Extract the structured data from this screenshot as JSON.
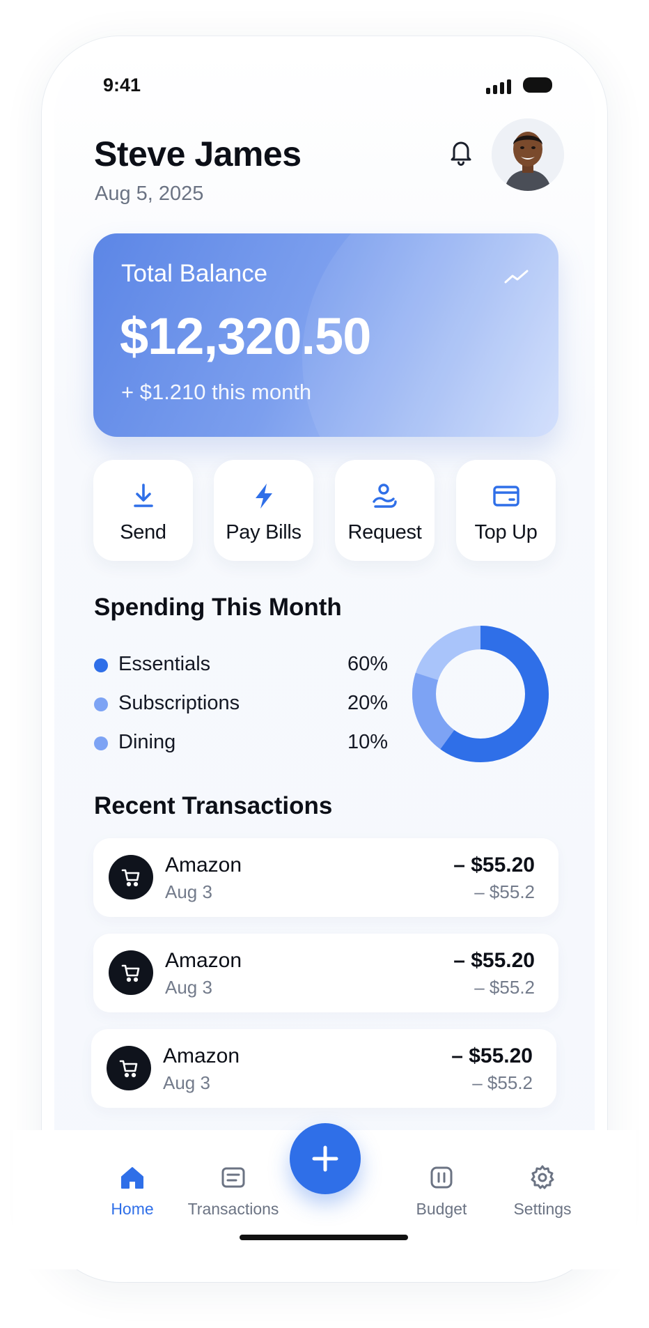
{
  "status_bar": {
    "time": "9:41"
  },
  "header": {
    "user_name": "Steve James",
    "date": "Aug 5, 2025"
  },
  "balance": {
    "label": "Total Balance",
    "amount": "$12,320.50",
    "change": "+ $1.210 this month"
  },
  "actions": [
    {
      "label": "Send",
      "icon": "download-arrow-icon"
    },
    {
      "label": "Pay Bills",
      "icon": "lightning-icon"
    },
    {
      "label": "Request",
      "icon": "request-person-icon"
    },
    {
      "label": "Top Up",
      "icon": "card-icon"
    }
  ],
  "spending": {
    "title": "Spending This Month",
    "items": [
      {
        "label": "Essentials",
        "value": "60%",
        "color": "#2f6fe8"
      },
      {
        "label": "Subscriptions",
        "value": "20%",
        "color": "#7da3f4"
      },
      {
        "label": "Dining",
        "value": "10%",
        "color": "#7da3f4"
      }
    ]
  },
  "transactions": {
    "title": "Recent Transactions",
    "items": [
      {
        "name": "Amazon",
        "date": "Aug 3",
        "amount": "– $55.20",
        "sub": "– $55.2"
      },
      {
        "name": "Amazon",
        "date": "Aug 3",
        "amount": "– $55.20",
        "sub": "– $55.2"
      },
      {
        "name": "Amazon",
        "date": "Aug 3",
        "amount": "– $55.20",
        "sub": "– $55.2"
      }
    ]
  },
  "nav": {
    "items": [
      {
        "label": "Home",
        "icon": "home-icon",
        "active": true
      },
      {
        "label": "Transactions",
        "icon": "list-icon",
        "active": false
      },
      {
        "label": "Budget",
        "icon": "budget-icon",
        "active": false
      },
      {
        "label": "Settings",
        "icon": "gear-icon",
        "active": false
      }
    ],
    "fab_icon": "plus-icon"
  },
  "colors": {
    "accent": "#2f6fe8",
    "accent_light": "#7da3f4",
    "donut_light": "#a9c4fa",
    "text_dark": "#0c0f17",
    "text_muted": "#6b7383"
  }
}
